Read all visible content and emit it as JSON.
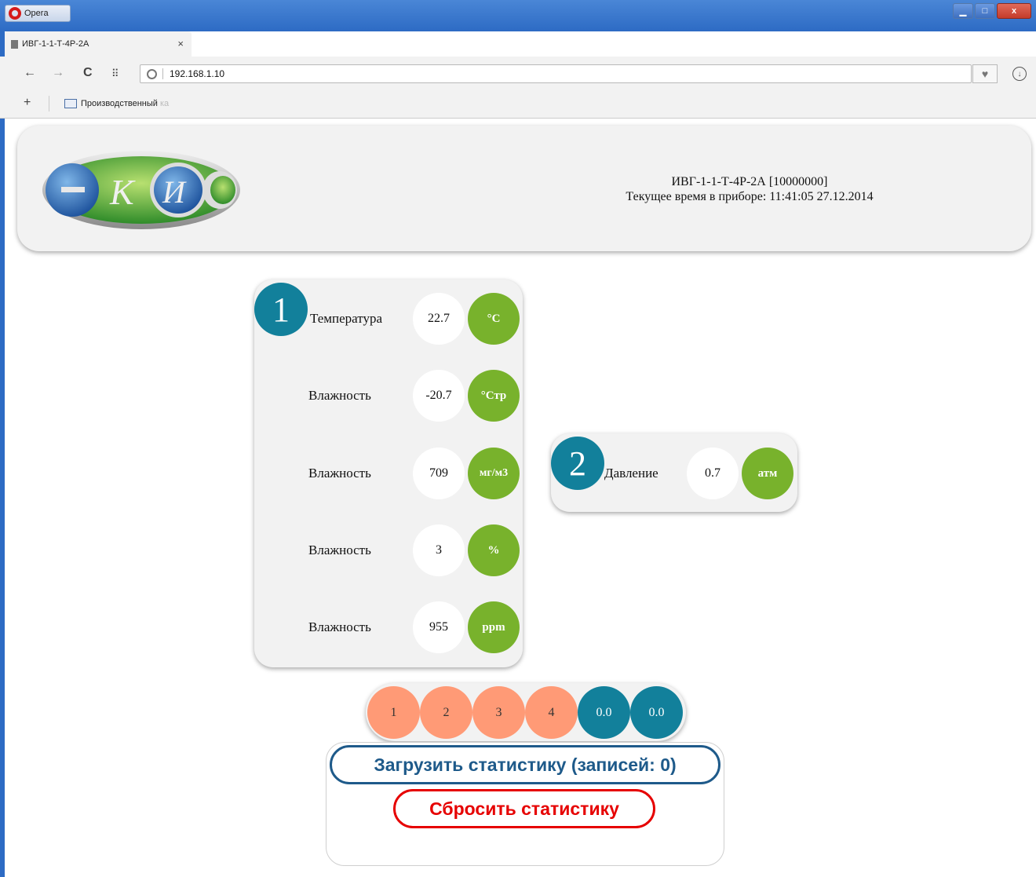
{
  "browser": {
    "app_button": "Opera",
    "tab_title": "ИВГ-1-1-Т-4Р-2А",
    "tab_close": "×",
    "new_tab": "+",
    "url": "192.168.1.10",
    "bookmark": "Производственный ",
    "bookmark_fade": "ка",
    "controls": {
      "minimize": "▁",
      "maximize": "□",
      "close": "x"
    }
  },
  "header": {
    "device_name": "ИВГ-1-1-Т-4Р-2А [10000000]",
    "device_time": "Текущее время в приборе: 11:41:05 27.12.2014"
  },
  "channel1": {
    "number": "1",
    "rows": [
      {
        "label": "Температура",
        "value": "22.7",
        "unit": "°C"
      },
      {
        "label": "Влажность",
        "value": "-20.7",
        "unit": "°Стр"
      },
      {
        "label": "Влажность",
        "value": "709",
        "unit": "мг/м3"
      },
      {
        "label": "Влажность",
        "value": "3",
        "unit": "%"
      },
      {
        "label": "Влажность",
        "value": "955",
        "unit": "ppm"
      }
    ]
  },
  "channel2": {
    "number": "2",
    "rows": [
      {
        "label": "Давление",
        "value": "0.7",
        "unit": "атм"
      }
    ]
  },
  "indicators": {
    "relays": [
      "1",
      "2",
      "3",
      "4"
    ],
    "counters": [
      "0.0",
      "0.0"
    ],
    "colors": {
      "relay": "#ff9a76",
      "counter": "#12809b"
    }
  },
  "statistics": {
    "load_label": "Загрузить статистику (записей: 0)",
    "reset_label": "Сбросить статистику"
  },
  "colors": {
    "channel": "#12809b",
    "unit": "#78b22c",
    "load": "#1e5a8a",
    "reset": "#e60000"
  }
}
